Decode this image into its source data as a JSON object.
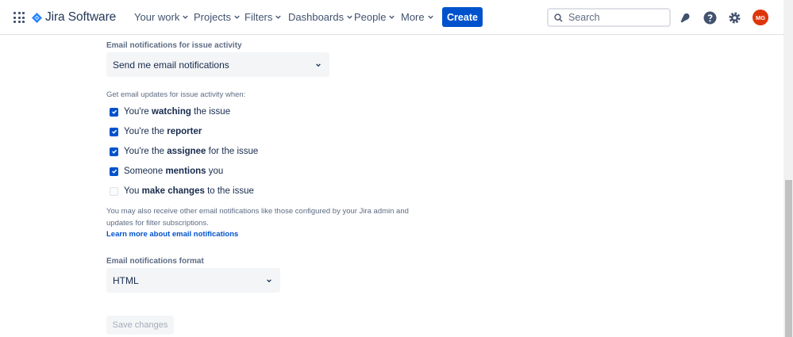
{
  "app": {
    "name": "Jira Software"
  },
  "nav": {
    "items": [
      "Your work",
      "Projects",
      "Filters",
      "Dashboards",
      "People",
      "More"
    ],
    "create_label": "Create"
  },
  "search": {
    "placeholder": "Search"
  },
  "user": {
    "initials": "MG"
  },
  "issue_activity": {
    "label": "Email notifications for issue activity",
    "selected": "Send me email notifications",
    "updates_hint": "Get email updates for issue activity when:",
    "options": [
      {
        "pre": "You're ",
        "bold": "watching",
        "post": " the issue",
        "checked": true
      },
      {
        "pre": "You're the ",
        "bold": "reporter",
        "post": "",
        "checked": true
      },
      {
        "pre": "You're the ",
        "bold": "assignee",
        "post": " for the issue",
        "checked": true
      },
      {
        "pre": "Someone ",
        "bold": "mentions",
        "post": " you",
        "checked": true
      },
      {
        "pre": "You ",
        "bold": "make changes",
        "post": " to the issue",
        "checked": false
      }
    ],
    "note": "You may also receive other email notifications like those configured by your Jira admin and updates for filter subscriptions.",
    "learn_more": "Learn more about email notifications"
  },
  "format": {
    "label": "Email notifications format",
    "selected": "HTML"
  },
  "save_label": "Save changes",
  "colors": {
    "accent": "#0052cc",
    "avatar": "#de350b"
  }
}
